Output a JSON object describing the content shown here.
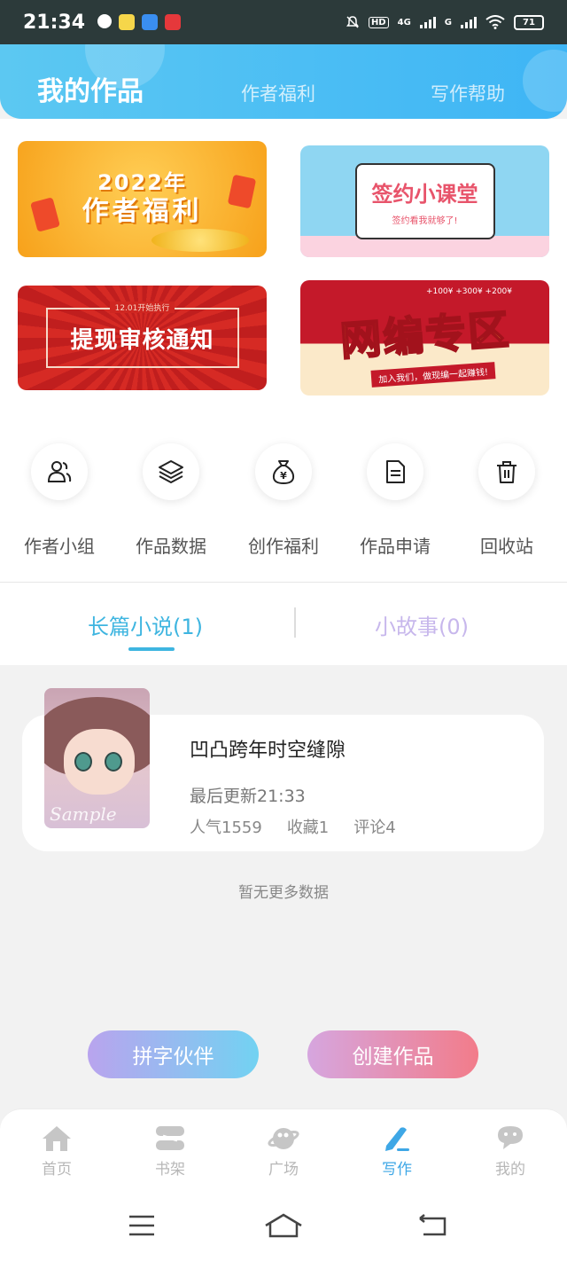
{
  "status_bar": {
    "time": "21:34",
    "network": "4G",
    "network2": "G",
    "hd": "HD",
    "battery": "71"
  },
  "header": {
    "tabs": [
      {
        "label": "我的作品",
        "active": true
      },
      {
        "label": "作者福利",
        "active": false
      },
      {
        "label": "写作帮助",
        "active": false
      }
    ],
    "gradient": [
      "#5cc8f2",
      "#3eb5f5"
    ]
  },
  "banners": {
    "welfare": {
      "year": "2022年",
      "title": "作者福利"
    },
    "course": {
      "title": "签约小课堂",
      "subtitle": "签约看我就够了!"
    },
    "withdraw": {
      "subtitle": "12.01开始执行",
      "title": "提现审核通知"
    },
    "web_editor": {
      "title": "网编专区",
      "subtitle": "加入我们，做现编一起赚钱!",
      "bonus": "+100¥  +300¥  +200¥"
    }
  },
  "quick_menu": [
    {
      "label": "作者小组",
      "icon": "users-icon"
    },
    {
      "label": "作品数据",
      "icon": "layers-icon"
    },
    {
      "label": "创作福利",
      "icon": "money-bag-icon"
    },
    {
      "label": "作品申请",
      "icon": "document-icon"
    },
    {
      "label": "回收站",
      "icon": "trash-icon"
    }
  ],
  "work_tabs": [
    {
      "label": "长篇小说(1)",
      "active": true
    },
    {
      "label": "小故事(0)",
      "active": false
    }
  ],
  "work": {
    "title": "凹凸跨年时空缝隙",
    "updated": "最后更新21:33",
    "popularity": "人气1559",
    "favorites": "收藏1",
    "comments": "评论4",
    "cover_stamp": "Sample"
  },
  "no_more": "暂无更多数据",
  "actions": {
    "partner": "拼字伙伴",
    "create": "创建作品"
  },
  "bottom_nav": [
    {
      "label": "首页",
      "icon": "home-icon",
      "active": false
    },
    {
      "label": "书架",
      "icon": "bookshelf-icon",
      "active": false
    },
    {
      "label": "广场",
      "icon": "planet-icon",
      "active": false
    },
    {
      "label": "写作",
      "icon": "pen-icon",
      "active": true
    },
    {
      "label": "我的",
      "icon": "chat-face-icon",
      "active": false
    }
  ],
  "colors": {
    "accent": "#3eb5e0",
    "active_nav": "#3ea7e6",
    "inactive_tab": "#c7b7ec"
  }
}
